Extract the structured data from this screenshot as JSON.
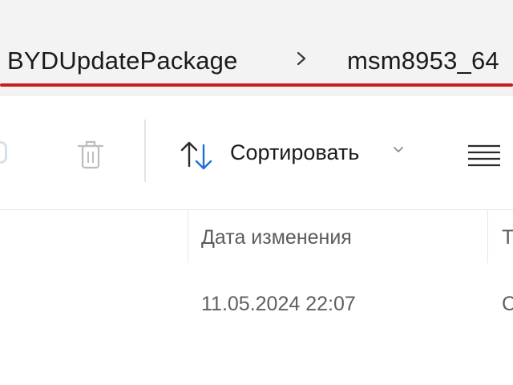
{
  "breadcrumb": {
    "items": [
      "BYDUpdatePackage",
      "msm8953_64"
    ],
    "separator": "›"
  },
  "toolbar": {
    "sort_label": "Сортировать",
    "icons": [
      "delete-icon",
      "sort-icon",
      "chevron-down-icon",
      "view-list-icon"
    ]
  },
  "columns": {
    "date_modified": "Дата изменения",
    "type": "Т"
  },
  "files": [
    {
      "date_modified": "11.05.2024 22:07",
      "type": "С"
    }
  ],
  "colors": {
    "accent_underline": "#c81d1d",
    "sort_icon_blue": "#1e6fd9",
    "address_bg": "#f3f3f3"
  }
}
